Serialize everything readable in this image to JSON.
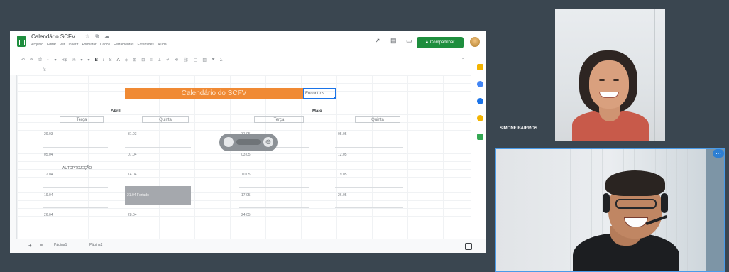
{
  "spreadsheet": {
    "doc_title": "Calendário SCFV",
    "menu": [
      "Arquivo",
      "Editar",
      "Ver",
      "Inserir",
      "Formatar",
      "Dados",
      "Ferramentas",
      "Extensões",
      "Ajuda"
    ],
    "share_label": "Compartilhar",
    "calendar_title": "Calendário do SCFV",
    "selected_cell_text": "Encontros",
    "months": [
      "Abril",
      "Maio"
    ],
    "day_headers": [
      "Terça",
      "Quinta",
      "Terça",
      "Quinta"
    ],
    "april_tuesday_dates": [
      "29.03",
      "05.04",
      "12.04",
      "19.04",
      "26.04"
    ],
    "april_thursday_dates": [
      "31.03",
      "07.04",
      "14.04",
      "21.04 Feriado",
      "28.04"
    ],
    "may_tuesday_dates": [
      "03.05",
      "10.05",
      "17.05",
      "24.05",
      "31.05"
    ],
    "may_thursday_dates": [
      "05.05",
      "12.05",
      "19.05",
      "26.05"
    ],
    "event_text": "AUTOPROJEÇÃO",
    "sheet_tabs": [
      "Página1",
      "Página2"
    ]
  },
  "participants": {
    "simone_name": "SIMONE BAIRROS"
  },
  "colors": {
    "title_fill": "#f08a34",
    "share_green": "#1e8e3e",
    "active_speaker_border": "#4a9be8"
  }
}
